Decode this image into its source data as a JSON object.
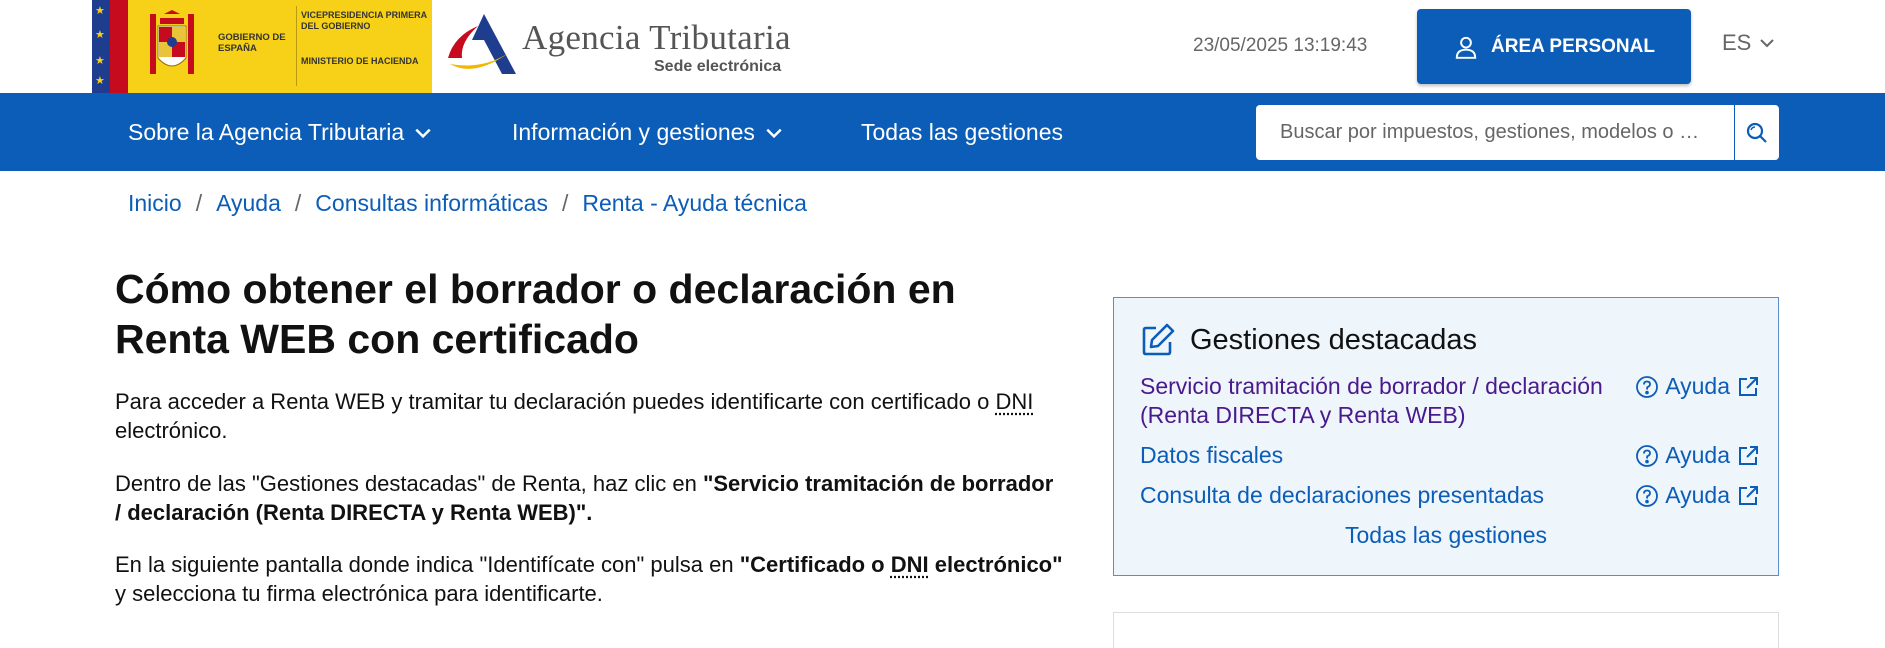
{
  "header": {
    "gov_name": "Gobierno de España",
    "gov_vice": "Vicepresidencia Primera del Gobierno",
    "gov_ministry": "Ministerio de Hacienda",
    "agency_title": "Agencia Tributaria",
    "agency_subtitle": "Sede electrónica",
    "datetime": "23/05/2025 13:19:43",
    "area_personal_label": "ÁREA PERSONAL",
    "language": "ES"
  },
  "nav": {
    "items": [
      {
        "label": "Sobre la Agencia Tributaria"
      },
      {
        "label": "Información y gestiones"
      },
      {
        "label": "Todas las gestiones"
      }
    ],
    "search_placeholder": "Buscar por impuestos, gestiones, modelos o …"
  },
  "breadcrumb": [
    "Inicio",
    "Ayuda",
    "Consultas informáticas",
    "Renta - Ayuda técnica"
  ],
  "main": {
    "title": "Cómo obtener el borrador o declaración en Renta WEB con certificado",
    "p1_text_a": "Para acceder a Renta WEB y tramitar tu declaración puedes identificarte con certificado o ",
    "p1_abbr": "DNI",
    "p1_text_b": " electrónico.",
    "p2_text_a": "Dentro de las \"Gestiones destacadas\" de Renta, haz clic en ",
    "p2_bold": "\"Servicio tramitación de borrador / declaración (Renta DIRECTA y Renta WEB)\".",
    "p3_text_a": "En la siguiente pantalla donde indica \"Identifícate con\" pulsa en ",
    "p3_bold_a": "\"Certificado o ",
    "p3_abbr": "DNI",
    "p3_bold_b": " electrónico\"",
    "p3_text_b": " y selecciona tu firma electrónica para identificarte."
  },
  "sidebar": {
    "title": "Gestiones destacadas",
    "help_label": "Ayuda",
    "items": [
      {
        "label": "Servicio tramitación de borrador / declaración (Renta DIRECTA y Renta WEB)"
      },
      {
        "label": "Datos fiscales"
      },
      {
        "label": "Consulta de declaraciones presentadas"
      }
    ],
    "all_label": "Todas las gestiones"
  },
  "colors": {
    "brand_blue": "#0b5db8",
    "gov_yellow": "#f7d117",
    "visited_link": "#4a1a8c"
  }
}
